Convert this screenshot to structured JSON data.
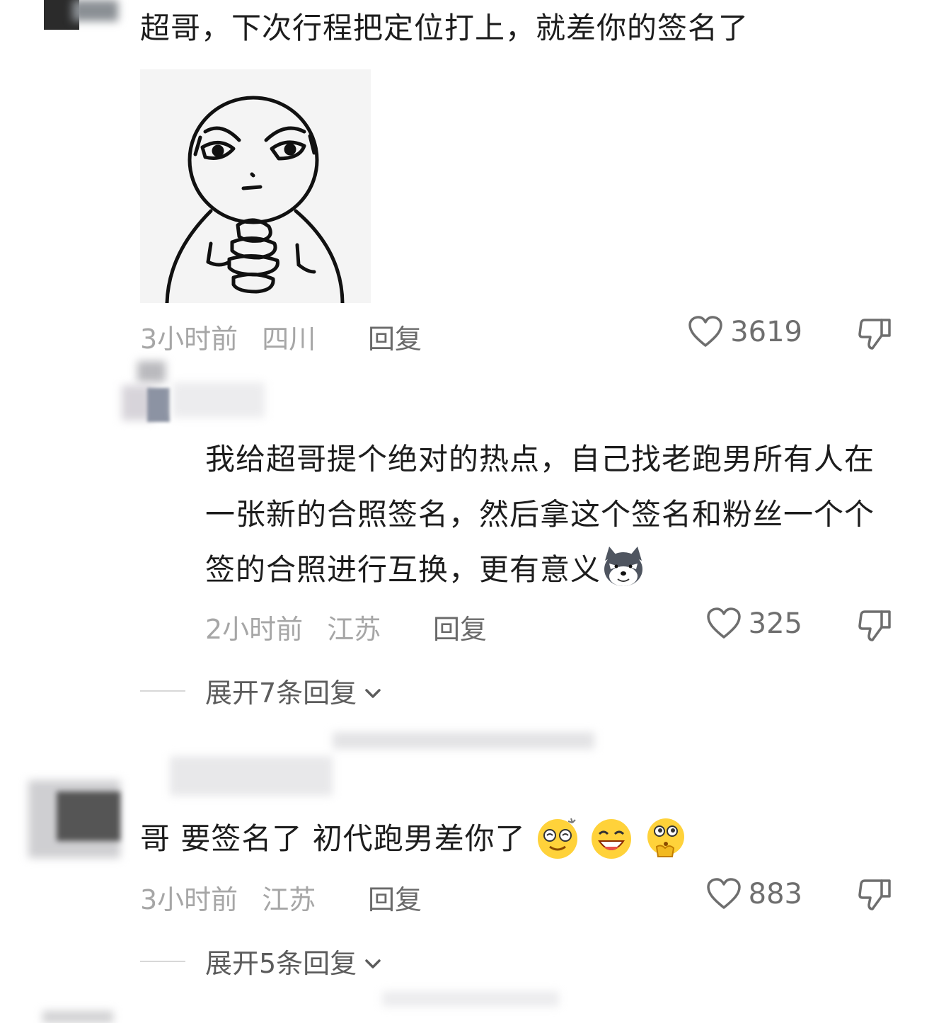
{
  "comments": [
    {
      "text": "超哥，下次行程把定位打上，就差你的签名了",
      "time": "3小时前",
      "location": "四川",
      "reply_label": "回复",
      "likes": "3619"
    },
    {
      "text": "我给超哥提个绝对的热点，自己找老跑男所有人在一张新的合照签名，然后拿这个签名和粉丝一个个签的合照进行互换，更有意义",
      "time": "2小时前",
      "location": "江苏",
      "reply_label": "回复",
      "likes": "325",
      "expand_label": "展开7条回复"
    },
    {
      "text": "哥 要签名了 初代跑男差你了",
      "time": "3小时前",
      "location": "江苏",
      "reply_label": "回复",
      "likes": "883",
      "expand_label": "展开5条回复"
    }
  ],
  "icons": {
    "like": "heart-outline-icon",
    "dislike": "thumbs-down-icon",
    "expand": "chevron-down-icon"
  },
  "colors": {
    "text": "#1d1d1d",
    "meta": "#a6a6a6",
    "icon": "#6e6e6e"
  }
}
